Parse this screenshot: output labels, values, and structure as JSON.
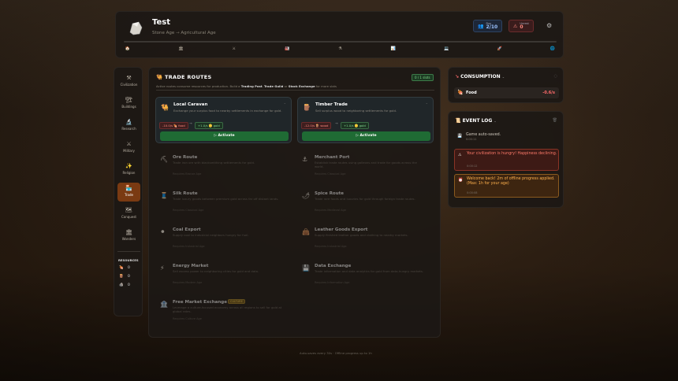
{
  "header": {
    "civ_name": "Test",
    "era_prefix": "Stone Age",
    "era_sep": "→",
    "era_current": "Agricultural Age",
    "pop_label": "Pop",
    "pop_value": "2/10",
    "unrest_label": "Unrest",
    "unrest_value": "0",
    "era_icons": [
      "🏠",
      "🏛",
      "⚔",
      "🏭",
      "⚗",
      "📊",
      "💻",
      "🚀",
      "🌐"
    ],
    "era_progress": 0
  },
  "sidebar": {
    "items": [
      {
        "icon": "⚒",
        "label": "Civilization"
      },
      {
        "icon": "🏗",
        "label": "Buildings"
      },
      {
        "icon": "🔬",
        "label": "Research"
      },
      {
        "icon": "⚔",
        "label": "Military"
      },
      {
        "icon": "✨",
        "label": "Religion"
      },
      {
        "icon": "🏪",
        "label": "Trade"
      },
      {
        "icon": "🗺",
        "label": "Conquest"
      },
      {
        "icon": "🏛",
        "label": "Wonders"
      }
    ],
    "active": "Trade",
    "resources_title": "RESOURCES",
    "resources": [
      {
        "icon": "🍖",
        "value": "0"
      },
      {
        "icon": "🪵",
        "value": "0"
      },
      {
        "icon": "🪨",
        "value": "0"
      }
    ]
  },
  "trade": {
    "title": "TRADE ROUTES",
    "slots": "0 / 1 slots",
    "subtitle_a": "Active routes consume resources for production. Build a",
    "subtitle_b": "Trading Post",
    "subtitle_c": "Trade Guild",
    "subtitle_d": "or",
    "subtitle_e": "Stock Exchange",
    "subtitle_f": "for more slots",
    "activate_label": "Activate",
    "active_routes": [
      {
        "icon": "🐫",
        "name": "Local Caravan",
        "desc": "Exchange your surplus food to nearby settlements in exchange for gold.",
        "cost": "-10.0/s 🍖 food",
        "gain": "+1.0/s 🪙 gold",
        "arrow": "→"
      },
      {
        "icon": "🪵",
        "name": "Timber Trade",
        "desc": "Sell surplus wood to neighboring settlements for gold.",
        "cost": "-12.0/s 🪵 wood",
        "gain": "+1.0/s 🪙 gold",
        "arrow": "→"
      }
    ],
    "locked_routes": [
      {
        "icon": "⛏",
        "name": "Ore Route",
        "desc": "Trade iron ore with blacksmithing settlements for gold.",
        "req": "Requires Bronze Age"
      },
      {
        "icon": "⚓",
        "name": "Merchant Port",
        "desc": "Establish trade routes using galleons and trade for goods across the world.",
        "req": "Requires Classical Age"
      },
      {
        "icon": "🧵",
        "name": "Silk Route",
        "desc": "Trade luxury goods between premium gold across far off distant lands.",
        "req": "Requires Classical Age"
      },
      {
        "icon": "🌶",
        "name": "Spice Route",
        "desc": "Trade rare foods and luxuries for gold through foreign trade routes.",
        "req": "Requires Medieval Age"
      },
      {
        "icon": "⚫",
        "name": "Coal Export",
        "desc": "Supply coal to industrial neighbors hungry for fuel.",
        "req": "Requires Industrial Age"
      },
      {
        "icon": "👜",
        "name": "Leather Goods Export",
        "desc": "Supply finished leather goods and clothing to nearby markets.",
        "req": "Requires Industrial Age"
      },
      {
        "icon": "⚡",
        "name": "Energy Market",
        "desc": "Sell excess power to neighboring cities for gold and data.",
        "req": "Requires Modern Age"
      },
      {
        "icon": "💾",
        "name": "Data Exchange",
        "desc": "Trade information and data analytics for gold from data-hungry markets.",
        "req": "Requires Information Age"
      },
      {
        "icon": "🏦",
        "name": "Free Market Exchange",
        "badge": "CULTURE",
        "desc": "Leverage a culture-focused economy across all regions to sell for gold at global rates.",
        "req": "Requires Culture Age"
      }
    ]
  },
  "consumption": {
    "title": "CONSUMPTION",
    "items": [
      {
        "icon": "🍖",
        "name": "Food",
        "value": "-0.6/s"
      }
    ]
  },
  "events": {
    "title": "EVENT LOG",
    "items": [
      {
        "icon": "💾",
        "text": "Game auto-saved.",
        "time": "0:00:11",
        "style": "plain"
      },
      {
        "icon": "⚠",
        "text": "Your civilization is hungry! Happiness declining.",
        "time": "0:00:12",
        "style": "red"
      },
      {
        "icon": "⏰",
        "text": "Welcome back! 2m of offline progress applied. (Max: 1h for your age)",
        "time": "0:00:08",
        "style": "org"
      }
    ]
  },
  "footer": "Auto-saves every 30s · Offline progress up to 1h"
}
